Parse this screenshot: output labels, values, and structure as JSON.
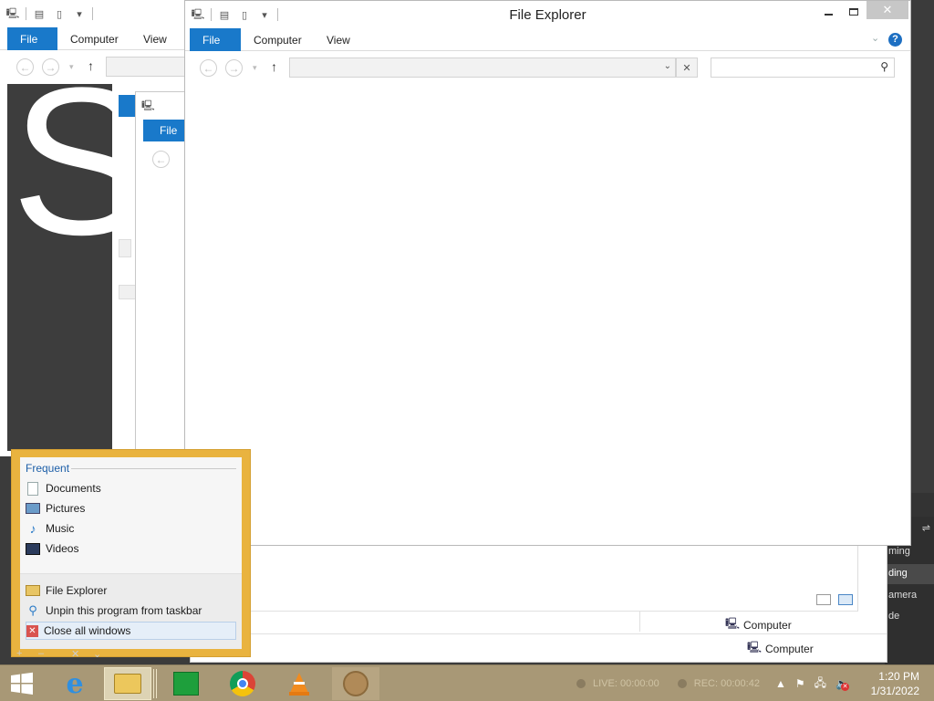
{
  "main_window": {
    "title": "File Explorer",
    "tabs": [
      "File",
      "Computer",
      "View"
    ],
    "help_icon": "?"
  },
  "bg_window1": {
    "tabs": [
      "File",
      "Computer",
      "View"
    ]
  },
  "bg_window2": {
    "tab_file": "File"
  },
  "bg_window3": {
    "status_computer": "Computer"
  },
  "bg_window4": {
    "status_computer": "Computer"
  },
  "side_panel": {
    "letter": "S",
    "items": [
      "ming",
      "ding",
      "amera",
      "de"
    ]
  },
  "jumplist": {
    "header": "Frequent",
    "frequent": [
      {
        "label": "Documents",
        "icon": "documents-icon"
      },
      {
        "label": "Pictures",
        "icon": "pictures-icon"
      },
      {
        "label": "Music",
        "icon": "music-icon"
      },
      {
        "label": "Videos",
        "icon": "videos-icon"
      }
    ],
    "tasks": [
      {
        "label": "File Explorer",
        "icon": "file-explorer-icon"
      },
      {
        "label": "Unpin this program from taskbar",
        "icon": "unpin-icon"
      },
      {
        "label": "Close all windows",
        "icon": "close-icon"
      }
    ]
  },
  "taskbar": {
    "live": "LIVE: 00:00:00",
    "rec": "REC: 00:00:42",
    "time": "1:20 PM",
    "date": "1/31/2022"
  }
}
